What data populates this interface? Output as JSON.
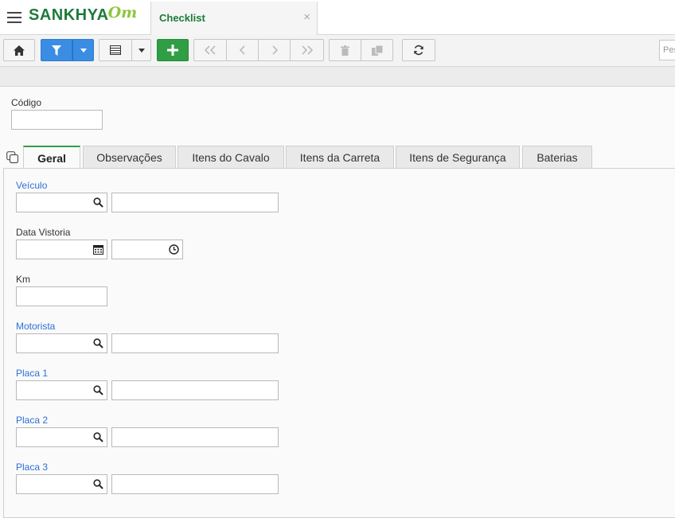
{
  "app": {
    "logo_text": "SANKHYA",
    "logo_suffix": "Om",
    "tab_title": "Checklist",
    "tab_close": "×"
  },
  "toolbar": {
    "search_placeholder": "Pes",
    "buttons": [
      "home-icon",
      "filter-icon",
      "dropdown-arrow-icon",
      "grid-icon",
      "dropdown-arrow-icon",
      "plus-icon",
      "first-icon",
      "prev-icon",
      "next-icon",
      "last-icon",
      "trash-icon",
      "copy-icon",
      "refresh-icon"
    ]
  },
  "codigo": {
    "label": "Código",
    "value": ""
  },
  "tabs": [
    {
      "label": "Geral",
      "active": true
    },
    {
      "label": "Observações",
      "active": false
    },
    {
      "label": "Itens do Cavalo",
      "active": false
    },
    {
      "label": "Itens da Carreta",
      "active": false
    },
    {
      "label": "Itens de Segurança",
      "active": false
    },
    {
      "label": "Baterias",
      "active": false
    }
  ],
  "form": {
    "veiculo": {
      "label": "Veículo",
      "code": "",
      "description": ""
    },
    "data_vistoria": {
      "label": "Data Vistoria",
      "date": "",
      "time": ""
    },
    "km": {
      "label": "Km",
      "value": ""
    },
    "motorista": {
      "label": "Motorista",
      "code": "",
      "description": ""
    },
    "placa1": {
      "label": "Placa 1",
      "code": "",
      "description": ""
    },
    "placa2": {
      "label": "Placa 2",
      "code": "",
      "description": ""
    },
    "placa3": {
      "label": "Placa 3",
      "code": "",
      "description": ""
    }
  },
  "colors": {
    "brand_green": "#1d7a3a",
    "logo_light_green": "#8dc63f",
    "filter_blue": "#3a8de3",
    "add_green": "#2f9e44",
    "link_blue": "#2e6fd6"
  }
}
